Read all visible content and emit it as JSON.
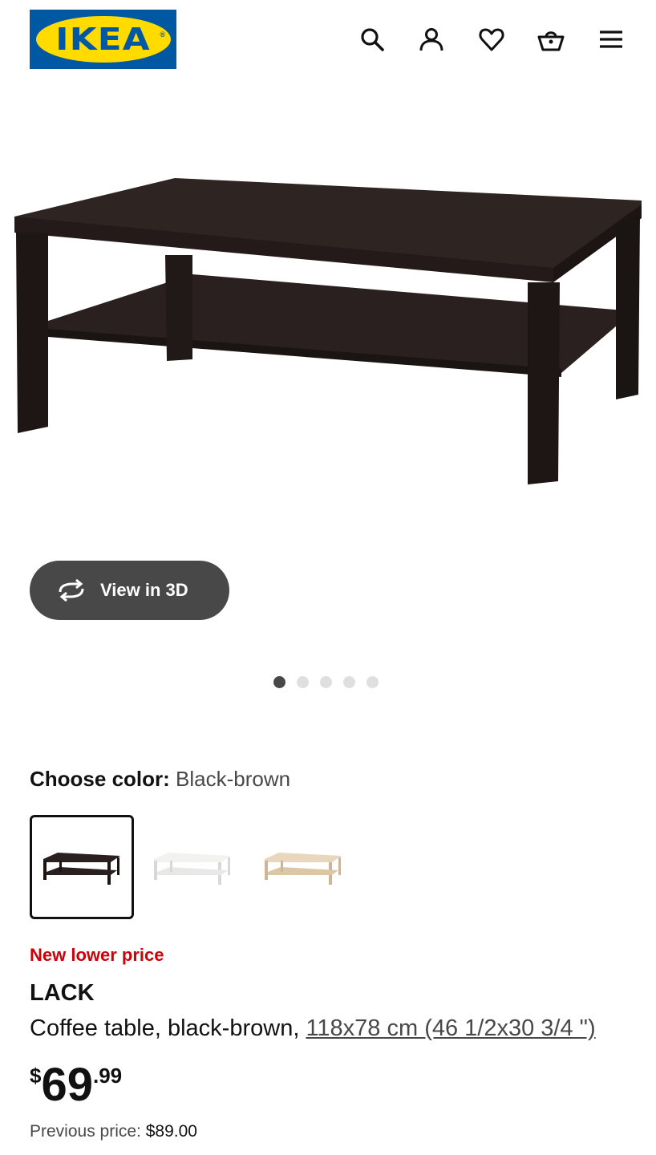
{
  "header": {
    "logo_text": "IKEA",
    "logo_reg": "®",
    "icons": [
      "search-icon",
      "account-icon",
      "heart-icon",
      "basket-icon",
      "menu-icon"
    ]
  },
  "hero": {
    "view3d_label": "View in 3D",
    "gallery_count": 5,
    "gallery_active": 1
  },
  "color": {
    "label": "Choose color:",
    "selected": "Black-brown",
    "options": [
      "black-brown",
      "white",
      "white-stained-oak"
    ]
  },
  "product": {
    "badge": "New lower price",
    "name": "LACK",
    "description": "Coffee table, black-brown, ",
    "size_link": "118x78 cm (46 1/2x30 3/4 \")",
    "price_currency": "$",
    "price_int": "69",
    "price_dec": ".99",
    "previous_label": "Previous price: ",
    "previous_price": "$89.00"
  },
  "colors": {
    "brand_blue": "#0058a3",
    "brand_yellow": "#ffdb00",
    "badge_red": "#cc0008",
    "button_dark": "#484848"
  }
}
